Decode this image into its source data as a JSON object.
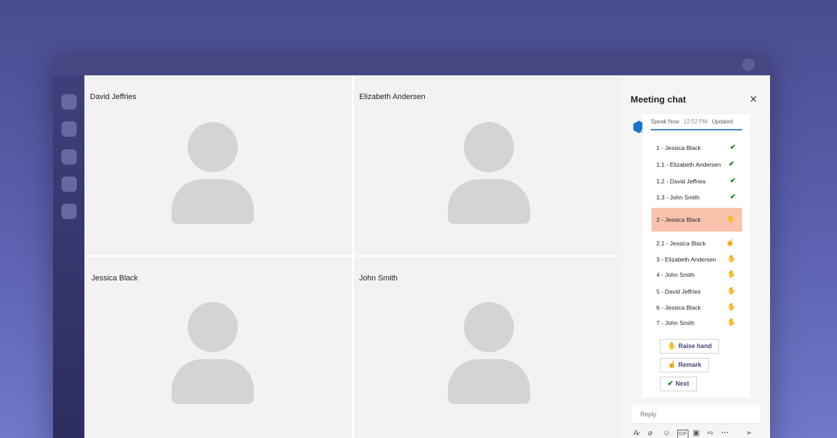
{
  "participants": [
    {
      "name": "David Jeffries"
    },
    {
      "name": "Elizabeth Andersen"
    },
    {
      "name": "Jessica Black"
    },
    {
      "name": "John Smith"
    }
  ],
  "chat": {
    "title": "Meeting chat",
    "close_icon": "close-icon",
    "card": {
      "sender": "Speak Now",
      "time": "12:52 PM",
      "status": "Updated",
      "queue": [
        {
          "label": "1 - Jessica Black",
          "state": "done"
        },
        {
          "label": "1.1 - Elizabeth Andersen",
          "state": "done"
        },
        {
          "label": "1.2 - David Jeffries",
          "state": "done"
        },
        {
          "label": "1.3 - John Smith",
          "state": "done"
        },
        {
          "label": "2 - Jessica Black",
          "state": "raised",
          "active": true
        },
        {
          "label": "2.1 - Jessica Black",
          "state": "remark"
        },
        {
          "label": "3 - Elizabeth Andersen",
          "state": "raised"
        },
        {
          "label": "4 - John Smith",
          "state": "raised"
        },
        {
          "label": "5 - David Jeffries",
          "state": "raised"
        },
        {
          "label": "6 - Jessica Black",
          "state": "raised"
        },
        {
          "label": "7 - John Smith",
          "state": "raised"
        }
      ],
      "actions": [
        {
          "label": "Raise hand",
          "icon": "raised-hand-icon"
        },
        {
          "label": "Remark",
          "icon": "pointing-hand-icon"
        },
        {
          "label": "Next",
          "icon": "checkmark-icon"
        }
      ]
    },
    "reply_placeholder": "Reply",
    "toolbar_icons": [
      "format-icon",
      "attach-icon",
      "emoji-icon",
      "gif-icon",
      "sticker-icon",
      "loop-icon",
      "more-icon",
      "send-icon"
    ]
  },
  "colors": {
    "accent": "#464775",
    "active_row": "#f9c3ad",
    "check": "#1e7b1e",
    "hand": "#d9a400"
  }
}
